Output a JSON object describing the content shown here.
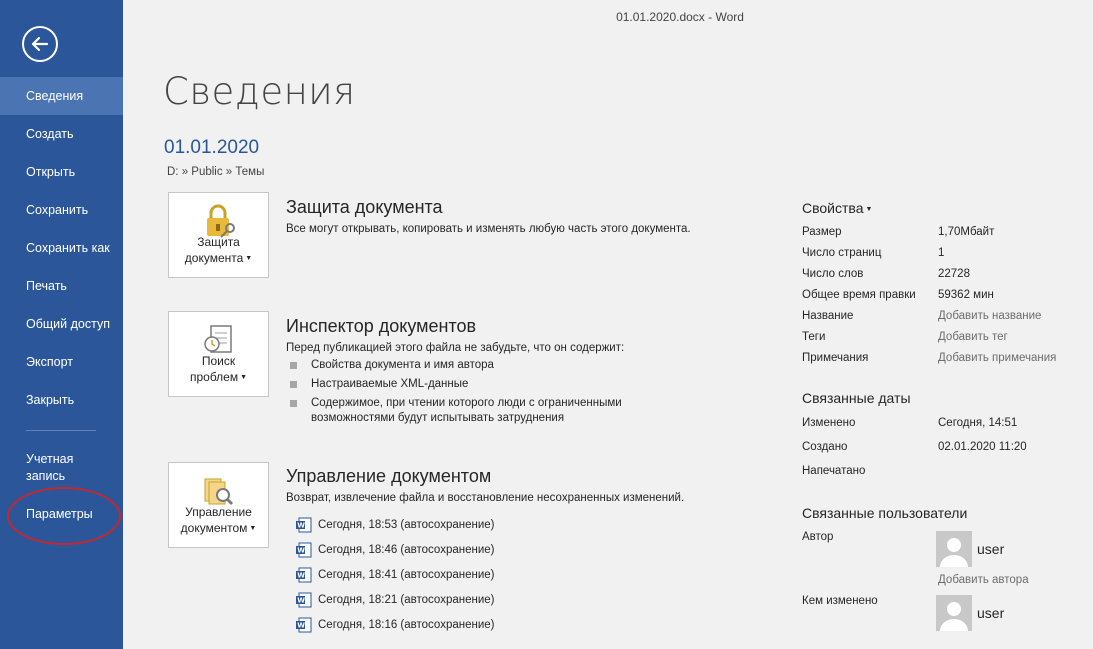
{
  "window_title": "01.01.2020.docx - Word",
  "nav": {
    "items": [
      {
        "label": "Сведения"
      },
      {
        "label": "Создать"
      },
      {
        "label": "Открыть"
      },
      {
        "label": "Сохранить"
      },
      {
        "label": "Сохранить как"
      },
      {
        "label": "Печать"
      },
      {
        "label": "Общий доступ"
      },
      {
        "label": "Экспорт"
      },
      {
        "label": "Закрыть"
      }
    ],
    "account": "Учетная запись",
    "options": "Параметры"
  },
  "main": {
    "page_title": "Сведения",
    "doc_name": "01.01.2020",
    "doc_path": "D: » Public » Темы",
    "protect": {
      "tile_label_1": "Защита",
      "tile_label_2": "документа",
      "title": "Защита документа",
      "desc": "Все могут открывать, копировать и изменять любую часть этого документа."
    },
    "inspect": {
      "tile_label_1": "Поиск",
      "tile_label_2": "проблем",
      "title": "Инспектор документов",
      "desc": "Перед публикацией этого файла не забудьте, что он содержит:",
      "bullets": [
        "Свойства документа и имя автора",
        "Настраиваемые XML-данные",
        "Содержимое, при чтении которого люди с ограниченными возможностями будут испытывать затруднения"
      ]
    },
    "manage": {
      "tile_label_1": "Управление",
      "tile_label_2": "документом",
      "title": "Управление документом",
      "desc": "Возврат, извлечение файла и восстановление несохраненных изменений.",
      "versions": [
        "Сегодня, 18:53 (автосохранение)",
        "Сегодня, 18:46 (автосохранение)",
        "Сегодня, 18:41 (автосохранение)",
        "Сегодня, 18:21 (автосохранение)",
        "Сегодня, 18:16 (автосохранение)"
      ]
    }
  },
  "properties": {
    "title": "Свойства",
    "rows": [
      {
        "key": "Размер",
        "value": "1,70Мбайт"
      },
      {
        "key": "Число страниц",
        "value": "1"
      },
      {
        "key": "Число слов",
        "value": "22728"
      },
      {
        "key": "Общее время правки",
        "value": "59362 мин"
      },
      {
        "key": "Название",
        "value": "Добавить название"
      },
      {
        "key": "Теги",
        "value": "Добавить тег"
      },
      {
        "key": "Примечания",
        "value": "Добавить примечания"
      }
    ]
  },
  "dates": {
    "title": "Связанные даты",
    "rows": [
      {
        "key": "Изменено",
        "value": "Сегодня, 14:51"
      },
      {
        "key": "Создано",
        "value": "02.01.2020 11:20"
      },
      {
        "key": "Напечатано",
        "value": ""
      }
    ]
  },
  "people": {
    "title": "Связанные пользователи",
    "author_label": "Автор",
    "author_name": "user",
    "add_author": "Добавить автора",
    "modified_label": "Кем изменено",
    "modified_name": "user"
  },
  "colors": {
    "sidebar": "#2b579a",
    "sidebar_active": "#4a74b2",
    "accent_link": "#2b579a",
    "highlight": "#c6262e"
  }
}
